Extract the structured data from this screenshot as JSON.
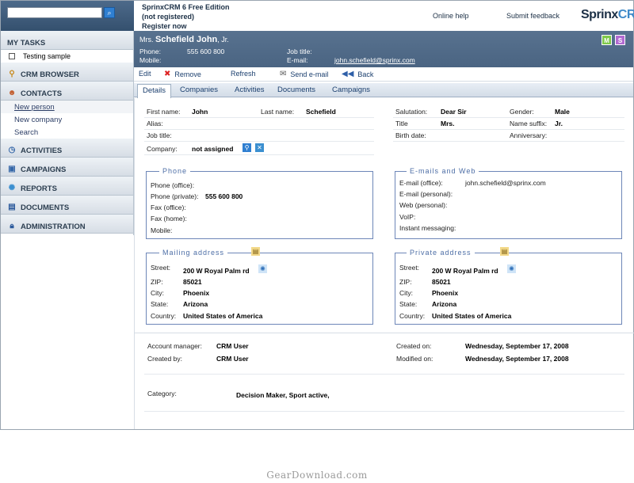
{
  "header": {
    "edition_line1": "SprinxCRM 6 Free Edition",
    "edition_line2": "(not registered)",
    "edition_line3": "Register now",
    "online_help": "Online help",
    "submit_feedback": "Submit feedback",
    "logo_a": "Sprinx",
    "logo_b": "CRM",
    "search_value": ""
  },
  "sidebar": {
    "my_tasks": "MY TASKS",
    "task_item": "Testing sample",
    "crm_browser": "CRM BROWSER",
    "contacts": "CONTACTS",
    "new_person": "New person",
    "new_company": "New company",
    "search": "Search",
    "activities": "ACTIVITIES",
    "campaigns": "CAMPAIGNS",
    "reports": "REPORTS",
    "documents": "DOCUMENTS",
    "administration": "ADMINISTRATION"
  },
  "contact": {
    "title": "Mrs.",
    "name": "Schefield John",
    "suffix": ", Jr.",
    "phone_label": "Phone:",
    "phone_value": "555 600 800",
    "mobile_label": "Mobile:",
    "job_title_label": "Job title:",
    "email_label": "E-mail:",
    "email_value": "john.schefield@sprinx.com",
    "badge_m": "M",
    "badge_s": "S",
    "badge_m_color": "#7fc94a",
    "badge_s_color": "#b26bd1"
  },
  "toolbar": {
    "edit": "Edit",
    "remove": "Remove",
    "refresh": "Refresh",
    "send_email": "Send e-mail",
    "back": "Back"
  },
  "tabs": [
    "Details",
    "Companies",
    "Activities",
    "Documents",
    "Campaigns"
  ],
  "details": {
    "first_name_label": "First name:",
    "first_name": "John",
    "last_name_label": "Last name:",
    "last_name": "Schefield",
    "alias_label": "Alias:",
    "job_title_label": "Job title:",
    "company_label": "Company:",
    "company": "not assigned",
    "salutation_label": "Salutation:",
    "salutation": "Dear Sir",
    "gender_label": "Gender:",
    "gender": "Male",
    "title_label": "Title",
    "title": "Mrs.",
    "name_suffix_label": "Name suffix:",
    "name_suffix": "Jr.",
    "birth_date_label": "Birth date:",
    "anniversary_label": "Anniversary:"
  },
  "phone_box": {
    "title": "Phone",
    "office_label": "Phone (office):",
    "private_label": "Phone (private):",
    "private_value": "555 600 800",
    "fax_office_label": "Fax (office):",
    "fax_home_label": "Fax (home):",
    "mobile_label": "Mobile:"
  },
  "email_box": {
    "title": "E-mails and Web",
    "office_label": "E-mail (office):",
    "office_value": "john.schefield@sprinx.com",
    "personal_label": "E-mail (personal):",
    "web_label": "Web (personal):",
    "voip_label": "VoIP:",
    "im_label": "Instant messaging:"
  },
  "mailing": {
    "title": "Mailing address",
    "street_label": "Street:",
    "street": "200 W Royal Palm rd",
    "zip_label": "ZIP:",
    "zip": "85021",
    "city_label": "City:",
    "city": "Phoenix",
    "state_label": "State:",
    "state": "Arizona",
    "country_label": "Country:",
    "country": "United States of America"
  },
  "private_addr": {
    "title": "Private address",
    "street_label": "Street:",
    "street": "200 W Royal Palm rd",
    "zip_label": "ZIP:",
    "zip": "85021",
    "city_label": "City:",
    "city": "Phoenix",
    "state_label": "State:",
    "state": "Arizona",
    "country_label": "Country:",
    "country": "United States of America"
  },
  "meta": {
    "account_manager_label": "Account manager:",
    "account_manager": "CRM User",
    "created_by_label": "Created by:",
    "created_by": "CRM User",
    "created_on_label": "Created on:",
    "created_on": "Wednesday, September 17, 2008",
    "modified_on_label": "Modified on:",
    "modified_on": "Wednesday, September 17, 2008",
    "category_label": "Category:",
    "category": "Decision Maker, Sport active,"
  },
  "watermark": "GearDownload.com"
}
